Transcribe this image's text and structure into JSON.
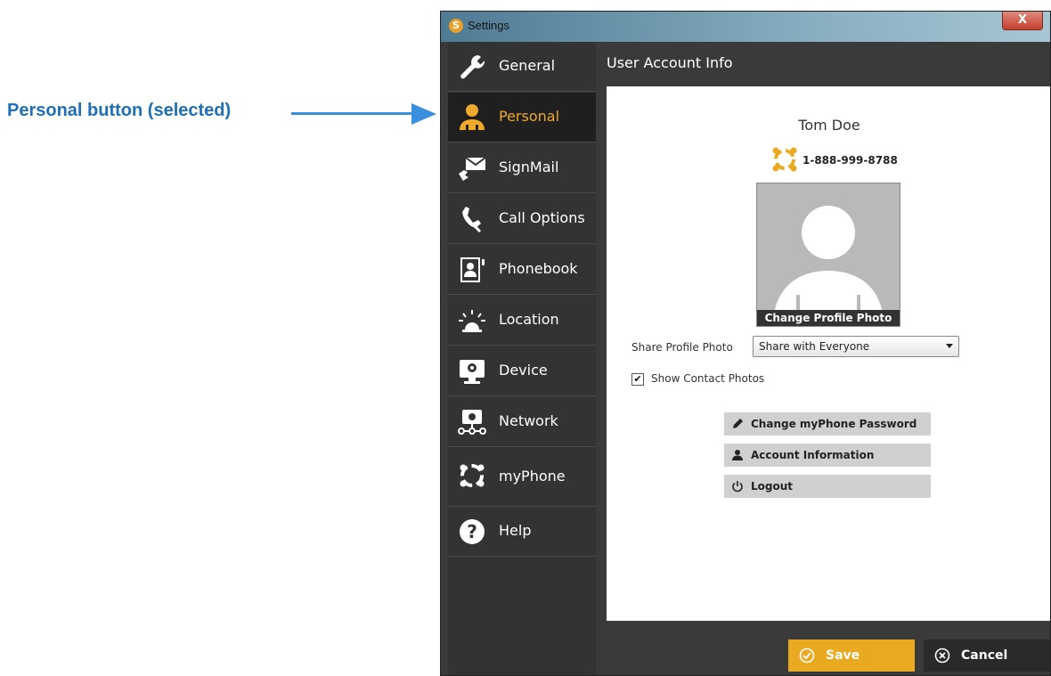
{
  "annotation": {
    "label": "Personal button (selected)"
  },
  "window": {
    "title": "Settings",
    "close_label": "X"
  },
  "sidebar": {
    "items": [
      {
        "label": "General",
        "icon": "wrench-icon"
      },
      {
        "label": "Personal",
        "icon": "person-icon",
        "selected": true
      },
      {
        "label": "SignMail",
        "icon": "signmail-icon"
      },
      {
        "label": "Call Options",
        "icon": "call-options-icon"
      },
      {
        "label": "Phonebook",
        "icon": "phonebook-icon"
      },
      {
        "label": "Location",
        "icon": "siren-icon"
      },
      {
        "label": "Device",
        "icon": "webcam-icon"
      },
      {
        "label": "Network",
        "icon": "network-icon"
      },
      {
        "label": "myPhone",
        "icon": "myphone-icon"
      },
      {
        "label": "Help",
        "icon": "help-icon"
      }
    ]
  },
  "content": {
    "header": "User Account Info",
    "user_name": "Tom Doe",
    "phone_number": "1-888-999-8788",
    "photo_caption": "Change Profile Photo",
    "share_label": "Share Profile Photo",
    "share_value": "Share with Everyone",
    "show_contact_label": "Show Contact Photos",
    "show_contact_checked": true,
    "actions": [
      {
        "label": "Change myPhone Password",
        "icon": "pencil-icon"
      },
      {
        "label": "Account Information",
        "icon": "person-icon"
      },
      {
        "label": "Logout",
        "icon": "power-icon"
      }
    ]
  },
  "footer": {
    "save_label": "Save",
    "cancel_label": "Cancel"
  },
  "colors": {
    "accent": "#e9a921",
    "callout": "#1d6fb8",
    "sidebar_bg": "#333333",
    "selected_bg": "#1f1f1f"
  }
}
